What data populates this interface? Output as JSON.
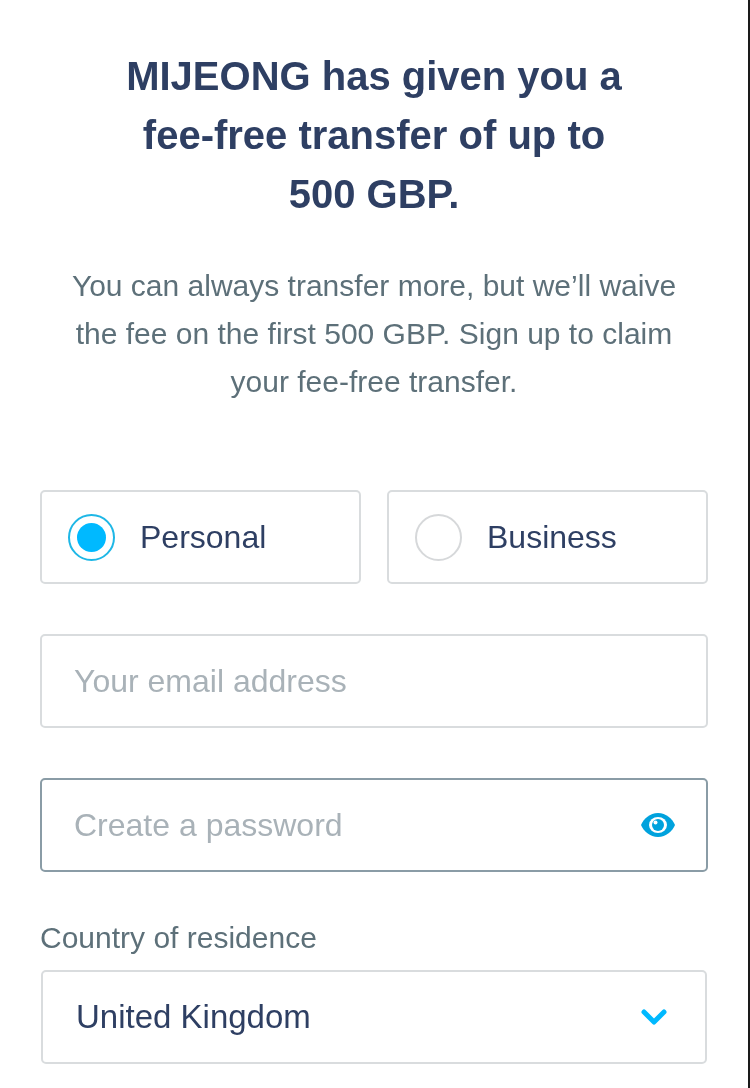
{
  "offer": {
    "heading": "MIJEONG has given you a fee-free transfer of up to 500 GBP.",
    "description": "You can always transfer more, but we’ll waive the fee on the first 500 GBP. Sign up to claim your fee-free transfer."
  },
  "account_types": [
    {
      "label": "Personal",
      "selected": true
    },
    {
      "label": "Business",
      "selected": false
    }
  ],
  "email": {
    "placeholder": "Your email address",
    "focused": false
  },
  "password": {
    "placeholder": "Create a password",
    "focused": true
  },
  "country": {
    "label": "Country of residence",
    "value": "United Kingdom"
  }
}
